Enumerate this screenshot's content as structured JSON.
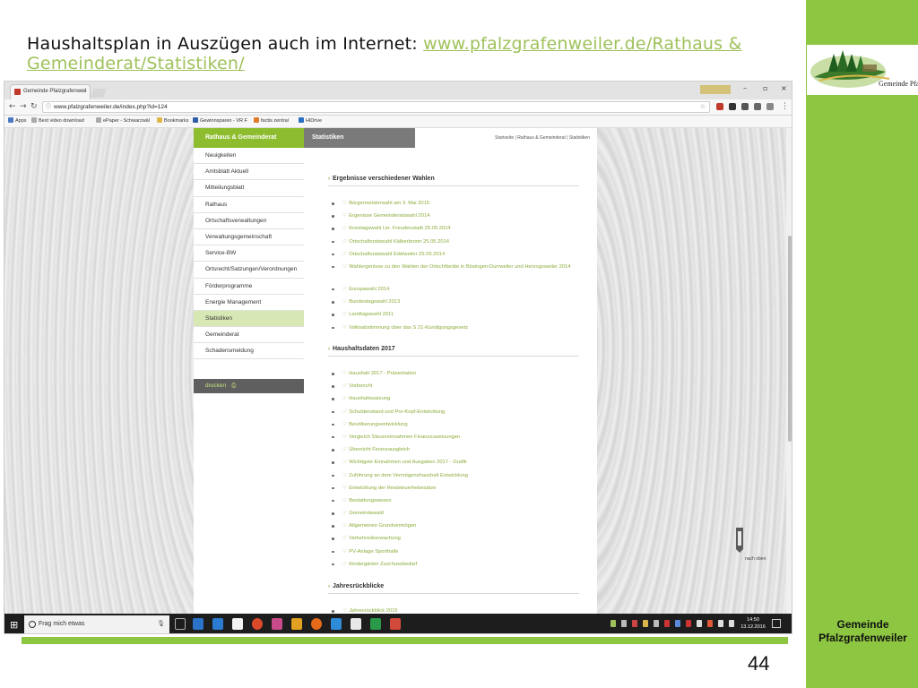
{
  "slide": {
    "title_text": "Haushaltsplan in Auszügen auch im Internet: ",
    "title_link": "www.pfalzgrafenweiler.de/Rathaus & Gemeinderat/Statistiken/",
    "logo_text": "Gemeinde Pfalzgrafenweiler",
    "footer_text": "Gemeinde Pfalzgrafenweiler",
    "page_number": "44",
    "accent_color": "#8dc641"
  },
  "browser": {
    "tab_title": "Gemeinde Pfalzgrafenweil",
    "tab_close": "×",
    "window_controls": [
      "–",
      "▫",
      "×"
    ],
    "url": "www.pfalzgrafenweiler.de/index.php?id=124",
    "bookmarks": [
      "Apps",
      "Best video download",
      "ePaper - Schwarzwäl",
      "Bookmarks",
      "Gewinnsparen - VR F",
      "factis zentral",
      "HiDrive"
    ]
  },
  "site": {
    "nav_header": "Rathaus & Gemeinderat",
    "nav_items": [
      "Neuigkeiten",
      "Amtsblatt Aktuell",
      "Mitteilungsblatt",
      "Rathaus",
      "Ortschaftsverwaltungen",
      "Verwaltungsgemeinschaft",
      "Service-BW",
      "Ortsrecht/Satzungen/Verordnungen",
      "Förderprogramme",
      "Energie Management",
      "Statistiken",
      "Gemeinderat",
      "Schadensmeldung"
    ],
    "active_nav": "Statistiken",
    "print_label": "drucken",
    "main_header": "Statistiken",
    "breadcrumb": "Startseite | Rathaus & Gemeinderat | Statistiken",
    "sections": [
      {
        "title": "Ergebnisse verschiedener Wahlen",
        "links": [
          "Bürgermeisterwahl am 3. Mai 2015",
          "Ergenisse Gemeinderatswahl 2014",
          "Kreistagswahl Lkr. Freudenstadt 25.05.2014",
          "Ortschaftsratswahl Kälberbronn 25.05.2014",
          "Ortschaftsratswahl Edelweiler 25.05.2014",
          "Wahlergenisse zu den Wahlen der Ortschftsräte in Bösingen-Durrweiler und Herzogsweiler 2014",
          "Europawahl 2014",
          "Bundestagswahl 2013",
          "Landtagswahl 2011",
          "Volksabstimmung über das S 21-Kündigungsgesetz"
        ]
      },
      {
        "title": "Haushaltsdaten 2017",
        "links": [
          "Haushalt 2017 - Präsentation",
          "Vorbericht",
          "Haushaltssatzung",
          "Schuldenstand und Pro-Kopf-Entwicklung",
          "Bevölkerungsentwicklung",
          "Vergleich Steuereinnahmen Finanzzuweisungen",
          "Übersicht Finanzausgleich",
          "Wichtigste Einnahmen und Ausgaben 2017 - Grafik",
          "Zuführung an dem Vermögenshaushalt Entwicklung",
          "Entwicklung der Realsteuerhebesätze",
          "Bestattungswesen",
          "Gemeindewald",
          "Allgemeines Grundvermögen",
          "Verkehrsüberwachung",
          "PV-Anlage Sporthalle",
          "Kindergärten Zuschussbedarf"
        ]
      },
      {
        "title": "Jahresrückblicke",
        "links": [
          "Jahresrückblick 2015"
        ]
      }
    ],
    "back_to_top": "nach oben"
  },
  "taskbar": {
    "search_placeholder": "Frag mich etwas",
    "time": "14:50",
    "date": "13.12.2016"
  }
}
